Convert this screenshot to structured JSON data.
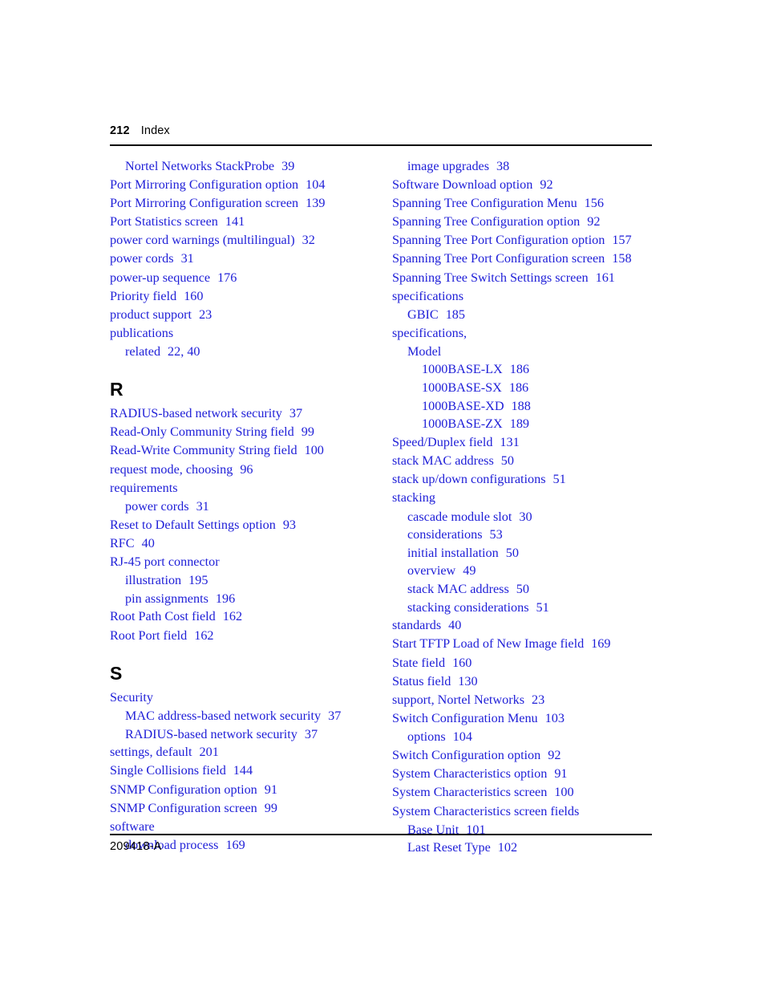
{
  "header": {
    "folio": "212",
    "title": "Index"
  },
  "footer": {
    "doc_number": "209418-A"
  },
  "colors": {
    "entry_link": "#2020D8",
    "text": "#000000",
    "rule": "#000000"
  },
  "left_column": [
    {
      "kind": "entry",
      "level": 1,
      "text": "Nortel Networks StackProbe",
      "page": "39"
    },
    {
      "kind": "entry",
      "level": 0,
      "text": "Port Mirroring Configuration option",
      "page": "104"
    },
    {
      "kind": "entry",
      "level": 0,
      "text": "Port Mirroring Configuration screen",
      "page": "139"
    },
    {
      "kind": "entry",
      "level": 0,
      "text": "Port Statistics screen",
      "page": "141"
    },
    {
      "kind": "entry",
      "level": 0,
      "text": "power cord warnings (multilingual)",
      "page": "32"
    },
    {
      "kind": "entry",
      "level": 0,
      "text": "power cords",
      "page": "31"
    },
    {
      "kind": "entry",
      "level": 0,
      "text": "power-up sequence",
      "page": "176"
    },
    {
      "kind": "entry",
      "level": 0,
      "text": "Priority field",
      "page": "160"
    },
    {
      "kind": "entry",
      "level": 0,
      "text": "product support",
      "page": "23"
    },
    {
      "kind": "entry",
      "level": 0,
      "text": "publications",
      "page": ""
    },
    {
      "kind": "entry",
      "level": 1,
      "text": "related",
      "page": "22, 40"
    },
    {
      "kind": "section",
      "letter": "R"
    },
    {
      "kind": "entry",
      "level": 0,
      "text": "RADIUS-based network security",
      "page": "37"
    },
    {
      "kind": "entry",
      "level": 0,
      "text": "Read-Only Community String field",
      "page": "99"
    },
    {
      "kind": "entry",
      "level": 0,
      "text": "Read-Write Community String field",
      "page": "100"
    },
    {
      "kind": "entry",
      "level": 0,
      "text": "request mode, choosing",
      "page": "96"
    },
    {
      "kind": "entry",
      "level": 0,
      "text": "requirements",
      "page": ""
    },
    {
      "kind": "entry",
      "level": 1,
      "text": "power cords",
      "page": "31"
    },
    {
      "kind": "entry",
      "level": 0,
      "text": "Reset to Default Settings option",
      "page": "93"
    },
    {
      "kind": "entry",
      "level": 0,
      "text": "RFC",
      "page": "40"
    },
    {
      "kind": "entry",
      "level": 0,
      "text": "RJ-45 port connector",
      "page": ""
    },
    {
      "kind": "entry",
      "level": 1,
      "text": "illustration",
      "page": "195"
    },
    {
      "kind": "entry",
      "level": 1,
      "text": "pin assignments",
      "page": "196"
    },
    {
      "kind": "entry",
      "level": 0,
      "text": "Root Path Cost field",
      "page": "162"
    },
    {
      "kind": "entry",
      "level": 0,
      "text": "Root Port field",
      "page": "162"
    },
    {
      "kind": "section",
      "letter": "S"
    },
    {
      "kind": "entry",
      "level": 0,
      "text": "Security",
      "page": ""
    },
    {
      "kind": "entry",
      "level": 1,
      "text": "MAC address-based network security",
      "page": "37"
    },
    {
      "kind": "entry",
      "level": 1,
      "text": "RADIUS-based network security",
      "page": "37"
    },
    {
      "kind": "entry",
      "level": 0,
      "text": "settings, default",
      "page": "201"
    },
    {
      "kind": "entry",
      "level": 0,
      "text": "Single Collisions field",
      "page": "144"
    },
    {
      "kind": "entry",
      "level": 0,
      "text": "SNMP Configuration option",
      "page": "91"
    },
    {
      "kind": "entry",
      "level": 0,
      "text": "SNMP Configuration screen",
      "page": "99"
    },
    {
      "kind": "entry",
      "level": 0,
      "text": "software",
      "page": ""
    },
    {
      "kind": "entry",
      "level": 1,
      "text": "download process",
      "page": "169"
    }
  ],
  "right_column": [
    {
      "kind": "entry",
      "level": 1,
      "text": "image upgrades",
      "page": "38"
    },
    {
      "kind": "entry",
      "level": 0,
      "text": "Software Download option",
      "page": "92"
    },
    {
      "kind": "entry",
      "level": 0,
      "text": "Spanning Tree Configuration Menu",
      "page": "156"
    },
    {
      "kind": "entry",
      "level": 0,
      "text": "Spanning Tree Configuration option",
      "page": "92"
    },
    {
      "kind": "entry",
      "level": 0,
      "text": "Spanning Tree Port Configuration option",
      "page": "157"
    },
    {
      "kind": "entry",
      "level": 0,
      "text": "Spanning Tree Port Configuration screen",
      "page": "158"
    },
    {
      "kind": "entry",
      "level": 0,
      "text": "Spanning Tree Switch Settings screen",
      "page": "161"
    },
    {
      "kind": "entry",
      "level": 0,
      "text": "specifications",
      "page": ""
    },
    {
      "kind": "entry",
      "level": 1,
      "text": "GBIC",
      "page": "185"
    },
    {
      "kind": "entry",
      "level": 0,
      "text": "specifications,",
      "page": ""
    },
    {
      "kind": "entry",
      "level": 1,
      "text": "Model",
      "page": ""
    },
    {
      "kind": "entry",
      "level": 2,
      "text": "1000BASE-LX",
      "page": "186"
    },
    {
      "kind": "entry",
      "level": 2,
      "text": "1000BASE-SX",
      "page": "186"
    },
    {
      "kind": "entry",
      "level": 2,
      "text": "1000BASE-XD",
      "page": "188"
    },
    {
      "kind": "entry",
      "level": 2,
      "text": "1000BASE-ZX",
      "page": "189"
    },
    {
      "kind": "entry",
      "level": 0,
      "text": "Speed/Duplex field",
      "page": "131"
    },
    {
      "kind": "entry",
      "level": 0,
      "text": "stack MAC address",
      "page": "50"
    },
    {
      "kind": "entry",
      "level": 0,
      "text": "stack up/down configurations",
      "page": "51"
    },
    {
      "kind": "entry",
      "level": 0,
      "text": "stacking",
      "page": ""
    },
    {
      "kind": "entry",
      "level": 1,
      "text": "cascade module slot",
      "page": "30"
    },
    {
      "kind": "entry",
      "level": 1,
      "text": "considerations",
      "page": "53"
    },
    {
      "kind": "entry",
      "level": 1,
      "text": "initial installation",
      "page": "50"
    },
    {
      "kind": "entry",
      "level": 1,
      "text": "overview",
      "page": "49"
    },
    {
      "kind": "entry",
      "level": 1,
      "text": "stack MAC address",
      "page": "50"
    },
    {
      "kind": "entry",
      "level": 1,
      "text": "stacking considerations",
      "page": "51"
    },
    {
      "kind": "entry",
      "level": 0,
      "text": "standards",
      "page": "40"
    },
    {
      "kind": "entry",
      "level": 0,
      "text": "Start TFTP Load of New Image field",
      "page": "169"
    },
    {
      "kind": "entry",
      "level": 0,
      "text": "State field",
      "page": "160"
    },
    {
      "kind": "entry",
      "level": 0,
      "text": "Status field",
      "page": "130"
    },
    {
      "kind": "entry",
      "level": 0,
      "text": "support, Nortel Networks",
      "page": "23"
    },
    {
      "kind": "entry",
      "level": 0,
      "text": "Switch Configuration Menu",
      "page": "103"
    },
    {
      "kind": "entry",
      "level": 1,
      "text": "options",
      "page": "104"
    },
    {
      "kind": "entry",
      "level": 0,
      "text": "Switch Configuration option",
      "page": "92"
    },
    {
      "kind": "entry",
      "level": 0,
      "text": "System Characteristics option",
      "page": "91"
    },
    {
      "kind": "entry",
      "level": 0,
      "text": "System Characteristics screen",
      "page": "100"
    },
    {
      "kind": "entry",
      "level": 0,
      "text": "System Characteristics screen fields",
      "page": ""
    },
    {
      "kind": "entry",
      "level": 1,
      "text": "Base Unit",
      "page": "101"
    },
    {
      "kind": "entry",
      "level": 1,
      "text": "Last Reset Type",
      "page": "102"
    }
  ]
}
